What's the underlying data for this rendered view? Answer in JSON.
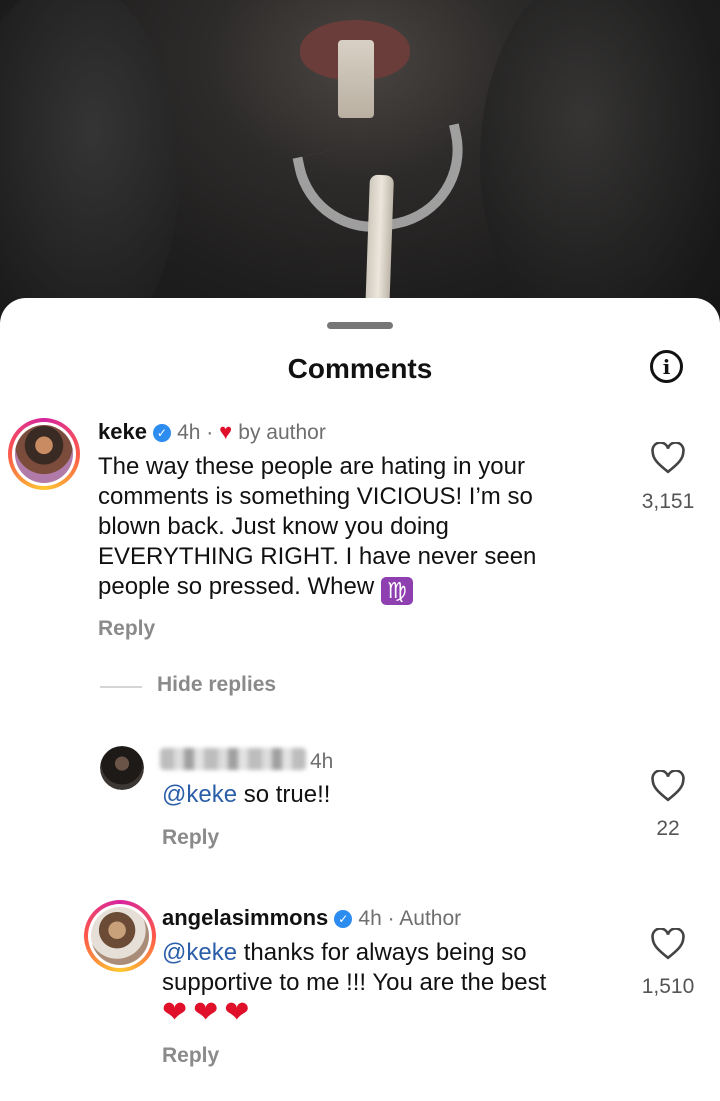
{
  "sheet": {
    "title": "Comments",
    "info_icon": "info-icon"
  },
  "comments": [
    {
      "username": "keke",
      "verified": true,
      "time": "4h",
      "liked_by_author_label": "by author",
      "text_lines": [
        "The way these people are hating in your",
        "comments is something VICIOUS! I’m so",
        "blown back. Just know you doing",
        "EVERYTHING RIGHT. I have never seen",
        "people so pressed. Whew "
      ],
      "emoji": "♍",
      "reply_label": "Reply",
      "like_count": "3,151"
    }
  ],
  "hide_replies_label": "Hide replies",
  "replies": [
    {
      "username_blurred": true,
      "time": "4h",
      "mention": "@keke",
      "text": " so true!!",
      "reply_label": "Reply",
      "like_count": "22"
    },
    {
      "username": "angelasimmons",
      "verified": true,
      "time": "4h",
      "author_label": "Author",
      "mention": "@keke",
      "text_line1": " thanks for always being so",
      "text_line2": "supportive to me !!! You are the best",
      "hearts": "❤❤❤",
      "reply_label": "Reply",
      "like_count": "1,510"
    }
  ],
  "colors": {
    "accent_blue": "#2b5ea8",
    "verified_blue": "#2d8cf0",
    "heart_red": "#e0102a"
  }
}
